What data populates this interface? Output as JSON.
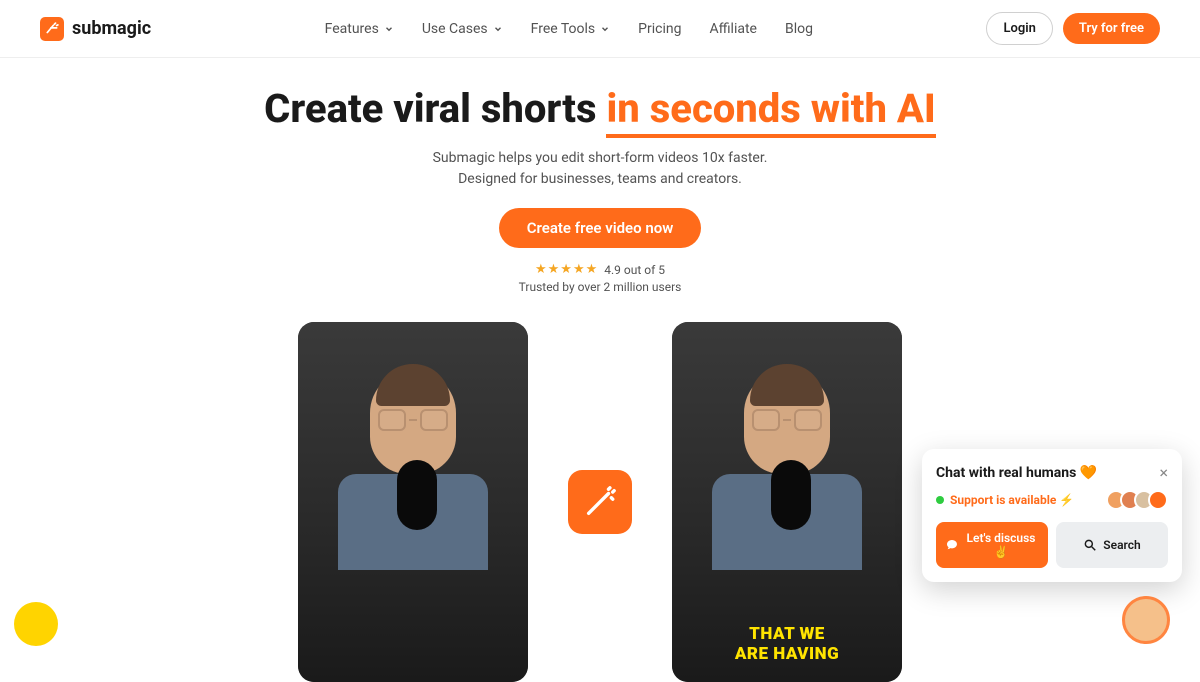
{
  "brand": {
    "name": "submagic"
  },
  "nav": {
    "features": "Features",
    "usecases": "Use Cases",
    "freetools": "Free Tools",
    "pricing": "Pricing",
    "affiliate": "Affiliate",
    "blog": "Blog"
  },
  "header": {
    "login": "Login",
    "try": "Try for free"
  },
  "hero": {
    "title_plain": "Create viral shorts ",
    "title_accent": "in seconds with AI",
    "sub_line1": "Submagic helps you edit short-form videos 10x faster.",
    "sub_line2": "Designed for businesses, teams and creators.",
    "cta": "Create free video now",
    "rating_text": "4.9 out of 5",
    "trusted": "Trusted by over 2 million users",
    "stars": "★★★★★"
  },
  "video": {
    "caption_line1": "THAT WE",
    "caption_line2": "ARE HAVING"
  },
  "chat": {
    "title": "Chat with real humans 🧡",
    "status": "Support is available ⚡",
    "discuss": "Let's discuss ✌️",
    "search": "Search"
  },
  "colors": {
    "accent": "#ff6b1a"
  }
}
